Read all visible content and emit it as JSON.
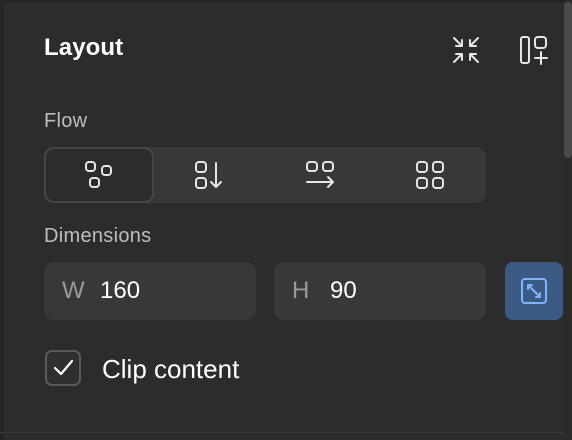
{
  "panel": {
    "title": "Layout",
    "header_icons": [
      "collapse-arrows-icon",
      "add-layout-icon"
    ]
  },
  "flow": {
    "label": "Flow",
    "selected_index": 0,
    "options": [
      {
        "icon": "freeform-flow-icon"
      },
      {
        "icon": "vertical-flow-icon"
      },
      {
        "icon": "horizontal-flow-icon"
      },
      {
        "icon": "grid-flow-icon"
      }
    ]
  },
  "dimensions": {
    "label": "Dimensions",
    "width": {
      "prefix": "W",
      "value": "160"
    },
    "height": {
      "prefix": "H",
      "value": "90"
    },
    "resize_to_fit_icon": "resize-to-fit-icon"
  },
  "clip": {
    "label": "Clip content",
    "checked": true
  },
  "colors": {
    "background": "#2c2c2c",
    "field": "#383838",
    "accent": "#3a5a85",
    "accent_icon": "#7db4ff",
    "muted_text": "#bdbdbd"
  }
}
